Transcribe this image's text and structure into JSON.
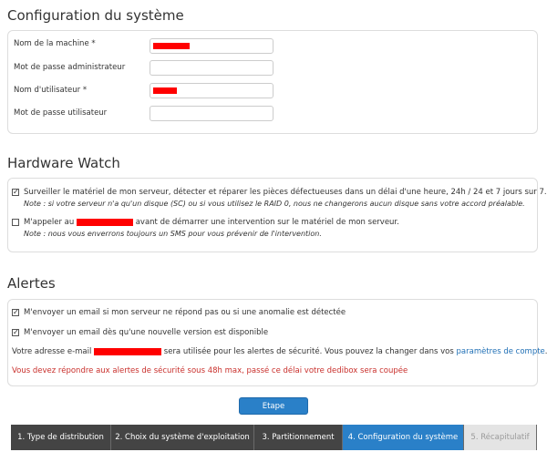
{
  "config": {
    "title": "Configuration du système",
    "fields": [
      {
        "label": "Nom de la machine *"
      },
      {
        "label": "Mot de passe administrateur"
      },
      {
        "label": "Nom d'utilisateur *"
      },
      {
        "label": "Mot de passe utilisateur"
      }
    ]
  },
  "hardware": {
    "title": "Hardware Watch",
    "item1": {
      "text": "Surveiller le matériel de mon serveur, détecter et réparer les pièces défectueuses dans un délai d'une heure, 24h / 24 et 7 jours sur 7.",
      "note": "Note : si votre serveur n'a qu'un disque (SC) ou si vous utilisez le RAID 0, nous ne changerons aucun disque sans votre accord préalable.",
      "checked": true
    },
    "item2": {
      "text_before": "M'appeler au",
      "text_after": "avant de démarrer une intervention sur le matériel de mon serveur.",
      "note": "Note : nous vous enverrons toujours un SMS pour vous prévenir de l'intervention.",
      "checked": false
    }
  },
  "alerts": {
    "title": "Alertes",
    "item1": {
      "text": "M'envoyer un email si mon serveur ne répond pas ou si une anomalie est détectée",
      "checked": true
    },
    "item2": {
      "text": "M'envoyer un email dès qu'une nouvelle version est disponible",
      "checked": true
    },
    "email_before": "Votre adresse e-mail",
    "email_after": "sera utilisée pour les alertes de sécurité. Vous pouvez la changer dans vos",
    "account_link": "paramètres de compte",
    "period": ".",
    "warning": "Vous devez répondre aux alertes de sécurité sous 48h max, passé ce délai votre dedibox sera coupée"
  },
  "next_button": "Etape suivante",
  "steps": [
    {
      "label": "1. Type de distribution",
      "state": "done"
    },
    {
      "label": "2. Choix du système d'exploitation",
      "state": "done"
    },
    {
      "label": "3. Partitionnement",
      "state": "done"
    },
    {
      "label": "4. Configuration du système",
      "state": "active"
    },
    {
      "label": "5. Récapitulatif",
      "state": "disabled"
    }
  ],
  "colors": {
    "accent": "#2a80c8",
    "step_dark": "#444444",
    "warning": "#c9302c",
    "link": "#1f6fb5",
    "redacted": "#ff0000"
  }
}
